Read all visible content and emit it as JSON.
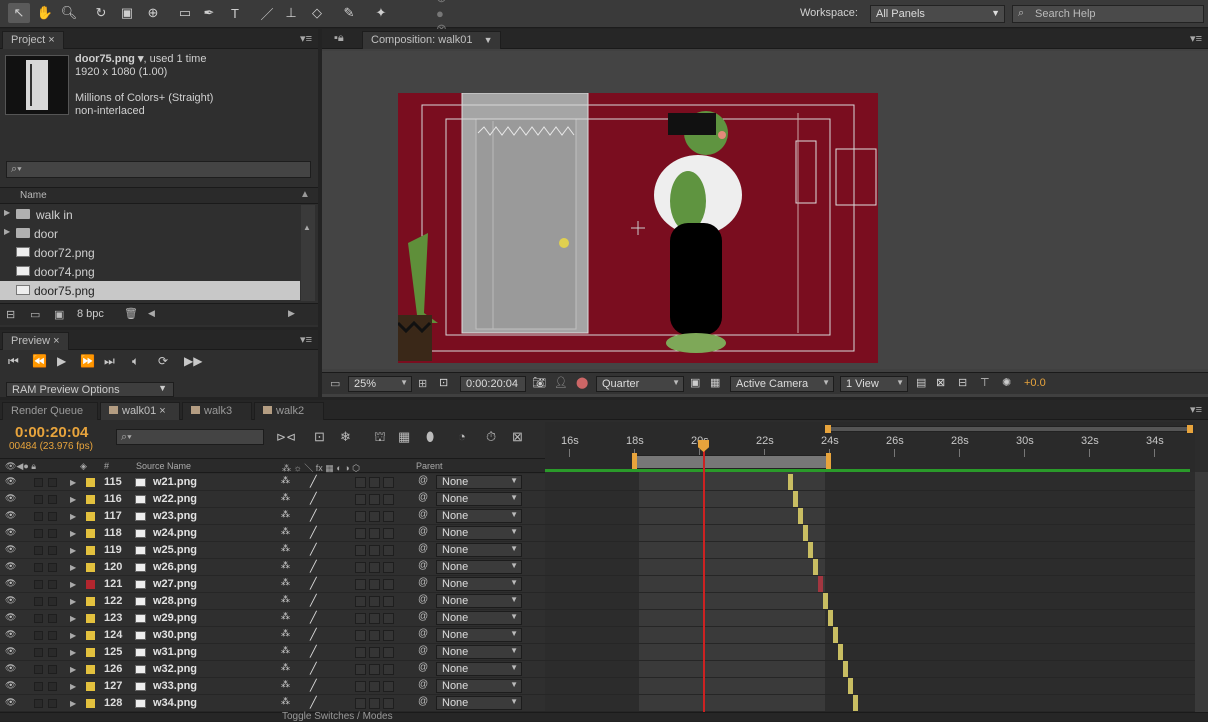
{
  "toolbar": {
    "tools": [
      "selection-tool",
      "hand-tool",
      "zoom-tool",
      "rotation-tool",
      "camera-tool",
      "pan-behind-tool",
      "rectangle-tool",
      "pen-tool",
      "type-tool",
      "brush-tool",
      "clone-stamp-tool",
      "eraser-tool",
      "roto-brush-tool",
      "puppet-pin-tool"
    ],
    "workspace_label": "Workspace:",
    "workspace_value": "All Panels",
    "search_placeholder": "Search Help"
  },
  "project": {
    "tab": "Project",
    "file_name": "door75.png ▾",
    "used": ", used 1 time",
    "dimensions": "1920 x 1080 (1.00)",
    "colors": "Millions of Colors+ (Straight)",
    "interlace": "non-interlaced",
    "search_placeholder": "",
    "column_name": "Name",
    "items": [
      {
        "label": "walk in",
        "type": "folder"
      },
      {
        "label": "door",
        "type": "folder"
      },
      {
        "label": "door72.png",
        "type": "file"
      },
      {
        "label": "door74.png",
        "type": "file"
      },
      {
        "label": "door75.png",
        "type": "file",
        "selected": true
      }
    ],
    "bpc": "8 bpc"
  },
  "preview": {
    "tab": "Preview",
    "ram_options": "RAM Preview Options"
  },
  "composition": {
    "tab": "Composition: walk01",
    "zoom": "25%",
    "timecode": "0:00:20:04",
    "resolution": "Quarter",
    "camera": "Active Camera",
    "view": "1 View",
    "exposure": "+0.0"
  },
  "timeline": {
    "tabs": [
      "Render Queue",
      "walk01",
      "walk3",
      "walk2"
    ],
    "active_tab": "walk01",
    "timecode": "0:00:20:04",
    "fps": "00484 (23.976 fps)",
    "search_placeholder": "",
    "columns": {
      "num": "#",
      "source": "Source Name",
      "parent": "Parent"
    },
    "ruler_ticks": [
      "16s",
      "18s",
      "20s",
      "22s",
      "24s",
      "26s",
      "28s",
      "30s",
      "32s",
      "34s"
    ],
    "layers": [
      {
        "num": "115",
        "name": "w21.png",
        "label_color": "#e3c13e",
        "parent": "None"
      },
      {
        "num": "116",
        "name": "w22.png",
        "label_color": "#e3c13e",
        "parent": "None"
      },
      {
        "num": "117",
        "name": "w23.png",
        "label_color": "#e3c13e",
        "parent": "None"
      },
      {
        "num": "118",
        "name": "w24.png",
        "label_color": "#e3c13e",
        "parent": "None"
      },
      {
        "num": "119",
        "name": "w25.png",
        "label_color": "#e3c13e",
        "parent": "None"
      },
      {
        "num": "120",
        "name": "w26.png",
        "label_color": "#e3c13e",
        "parent": "None"
      },
      {
        "num": "121",
        "name": "w27.png",
        "label_color": "#b2262e",
        "parent": "None"
      },
      {
        "num": "122",
        "name": "w28.png",
        "label_color": "#e3c13e",
        "parent": "None"
      },
      {
        "num": "123",
        "name": "w29.png",
        "label_color": "#e3c13e",
        "parent": "None"
      },
      {
        "num": "124",
        "name": "w30.png",
        "label_color": "#e3c13e",
        "parent": "None"
      },
      {
        "num": "125",
        "name": "w31.png",
        "label_color": "#e3c13e",
        "parent": "None"
      },
      {
        "num": "126",
        "name": "w32.png",
        "label_color": "#e3c13e",
        "parent": "None"
      },
      {
        "num": "127",
        "name": "w33.png",
        "label_color": "#e3c13e",
        "parent": "None"
      },
      {
        "num": "128",
        "name": "w34.png",
        "label_color": "#e3c13e",
        "parent": "None"
      }
    ],
    "footer": "Toggle Switches / Modes"
  }
}
